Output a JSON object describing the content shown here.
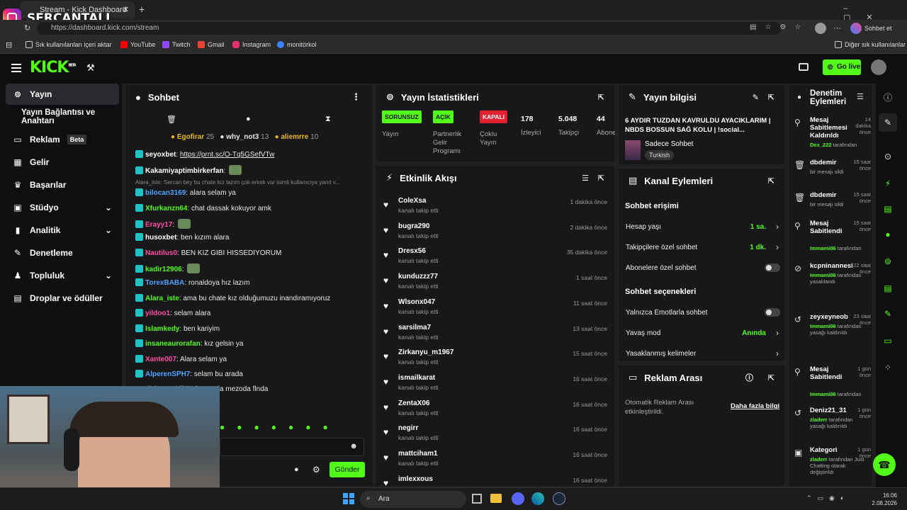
{
  "browser": {
    "tab_title": "Stream - Kick Dashboard",
    "url": "https://dashboard.kick.com/stream",
    "bookmarks": [
      "Sık kullanılanları içeri aktar",
      "YouTube",
      "Twitch",
      "Gmail",
      "Instagram",
      "monitörkol"
    ],
    "other_bookmarks": "Diğer sık kullanılanlar",
    "chat_button": "Sohbet et"
  },
  "overlay": {
    "streamer": "SERCANTALL"
  },
  "header": {
    "logo": "KICK",
    "logo_sup": "BETA",
    "go_live": "Go live"
  },
  "sidebar": {
    "items": [
      {
        "label": "Yayın",
        "icon": "broadcast-icon"
      },
      {
        "label": "Yayın Bağlantısı ve Anahtarı"
      },
      {
        "label": "Reklam",
        "badge": "Beta"
      },
      {
        "label": "Gelir"
      },
      {
        "label": "Başarılar"
      },
      {
        "label": "Stüdyo"
      },
      {
        "label": "Analitik"
      },
      {
        "label": "Denetleme"
      },
      {
        "label": "Topluluk"
      },
      {
        "label": "Droplar ve ödüller"
      }
    ]
  },
  "chat": {
    "title": "Sohbet",
    "top": [
      {
        "name": "Egofirar",
        "n": "25",
        "color": "#e8b923"
      },
      {
        "name": "why_not3",
        "n": "13",
        "color": "#ffffff"
      },
      {
        "name": "aliemrre",
        "n": "10",
        "color": "#e8b923"
      }
    ],
    "messages": [
      {
        "user": "seyoxbet",
        "color": "#ffffff",
        "text": "https://prnt.sc/O-Tq5GSefVTw"
      },
      {
        "user": "Kakamiyaptimbirkerfan",
        "color": "#ffffff",
        "text": ""
      },
      {
        "user": "",
        "color": "#888888",
        "text": "Alara_iste: Sercan bey bu chate kız lazım çok erkek var isimli kullanıcıya yanıt v..."
      },
      {
        "user": "bilocan3169",
        "color": "#4fa3ff",
        "text": "alara selam ya"
      },
      {
        "user": "Xfurkanzn64",
        "color": "#53fc18",
        "text": "chat dassak kokuyor amk"
      },
      {
        "user": "Erayy17",
        "color": "#ff4fa3",
        "text": ""
      },
      {
        "user": "husoxbet",
        "color": "#ffffff",
        "text": "ben kızım alara"
      },
      {
        "user": "Nautilus0",
        "color": "#ff4fa3",
        "text": "BEN KIZ GIBI HISSEDIYORUM"
      },
      {
        "user": "kadir12906",
        "color": "#53fc18",
        "text": ""
      },
      {
        "user": "TorexBABA",
        "color": "#4fa3ff",
        "text": "ronaldoya hız lazım"
      },
      {
        "user": "Alara_iste",
        "color": "#53fc18",
        "text": "ama bu chate kız olduğumuzu inandıramıyoruz"
      },
      {
        "user": "yildoo1",
        "color": "#ff4fa3",
        "text": "selam alara"
      },
      {
        "user": "Islamkedy",
        "color": "#53fc18",
        "text": "ben kariyim"
      },
      {
        "user": "insaneaurorafan",
        "color": "#53fc18",
        "text": "kız gelsin ya"
      },
      {
        "user": "Xante007",
        "color": "#ff4fa3",
        "text": "Alara selam ya"
      },
      {
        "user": "AlperenSPH7",
        "color": "#4fa3ff",
        "text": "selam bu arada"
      },
      {
        "user": "",
        "color": "#ffffff",
        "text": "modluk yapabilitim bu arada mezoda flnda"
      }
    ],
    "send": "Gönder"
  },
  "stats": {
    "title": "Yayın İstatistikleri",
    "items": [
      {
        "tag": "SORUNSUZ",
        "tag_color": "#53fc18",
        "label": "Yayın"
      },
      {
        "tag": "AÇIK",
        "tag_color": "#53fc18",
        "label": "Partnerlik Gelir Programı"
      },
      {
        "tag": "KAPALI",
        "tag_color": "#e5202e",
        "label": "Çoklu Yayın"
      },
      {
        "num": "178",
        "label": "İzleyici"
      },
      {
        "num": "5.048",
        "label": "Takipçi"
      },
      {
        "num": "44",
        "label": "Abone Sayısı"
      }
    ]
  },
  "events": {
    "title": "Etkinlik Akışı",
    "items": [
      {
        "name": "ColeXsa",
        "sub": "kanalı takip etti",
        "time": "1 dakika önce"
      },
      {
        "name": "bugra290",
        "sub": "kanalı takip etti",
        "time": "2 dakika önce"
      },
      {
        "name": "Dresx56",
        "sub": "kanalı takip etti",
        "time": "35 dakika önce"
      },
      {
        "name": "kunduzzz77",
        "sub": "kanalı takip etti",
        "time": "1 saat önce"
      },
      {
        "name": "Wlsonx047",
        "sub": "kanalı takip etti",
        "time": "11 saat önce"
      },
      {
        "name": "sarsilma7",
        "sub": "kanalı takip etti",
        "time": "13 saat önce"
      },
      {
        "name": "Zirkanyu_m1967",
        "sub": "kanalı takip etti",
        "time": "15 saat önce"
      },
      {
        "name": "ismailkarat",
        "sub": "kanalı takip etti",
        "time": "16 saat önce"
      },
      {
        "name": "ZentaX06",
        "sub": "kanalı takip etti",
        "time": "16 saat önce"
      },
      {
        "name": "negirr",
        "sub": "kanalı takip etti",
        "time": "16 saat önce"
      },
      {
        "name": "mattciham1",
        "sub": "kanalı takip etti",
        "time": "16 saat önce"
      },
      {
        "name": "imlexxous",
        "sub": "",
        "time": "16 saat önce"
      }
    ]
  },
  "info": {
    "title": "Yayın bilgisi",
    "stream_title": "6 AYDIR TUZDAN KAVRULDU AYACIKLARIM | NBDS BOSSUN SAĞ KOLU | !social...",
    "category": "Sadece Sohbet",
    "lang": "Turkish"
  },
  "actions": {
    "title": "Kanal Eylemleri",
    "access_title": "Sohbet erişimi",
    "rows": [
      {
        "label": "Hesap yaşı",
        "value": "1 sa."
      },
      {
        "label": "Takipçilere özel sohbet",
        "value": "1 dk."
      },
      {
        "label": "Abonelere özel sohbet",
        "toggle": true
      }
    ],
    "options_title": "Sohbet seçenekleri",
    "rows2": [
      {
        "label": "Yalnızca Emotlarla sohbet",
        "toggle": true
      },
      {
        "label": "Yavaş mod",
        "value": "Anında"
      },
      {
        "label": "Yasaklanmış kelimeler"
      }
    ]
  },
  "ads": {
    "title": "Reklam Arası",
    "text": "Otomatik Reklam Arası etkinleştirildi.",
    "link": "Daha fazla bilgi"
  },
  "mod": {
    "title": "Denetim Eylemleri",
    "items": [
      {
        "icon": "pin-icon",
        "title": "Mesaj Sabitlemesi Kaldırıldı",
        "when": "14 dakika önce",
        "by": "Dex_222",
        "sub": "tarafından"
      },
      {
        "icon": "trash-icon",
        "title": "dbdemir",
        "when": "15 saat önce",
        "by": "",
        "sub": "bir mesajı sildi"
      },
      {
        "icon": "trash-icon",
        "title": "dbdemir",
        "when": "15 saat önce",
        "by": "",
        "sub": "bir mesajı sildi"
      },
      {
        "icon": "pin-icon",
        "title": "Mesaj Sabitlendi",
        "when": "15 saat önce",
        "by": "Immami06",
        "sub": "tarafından"
      },
      {
        "icon": "ban-icon",
        "title": "kcpninannesi",
        "when": "22 saat önce",
        "by": "Immami06",
        "sub": "tarafından yasaklandı"
      },
      {
        "icon": "undo-icon",
        "title": "zeyxeyneob",
        "when": "23 saat önce",
        "by": "Immami06",
        "sub": "tarafından yasağı kaldırıldı"
      },
      {
        "icon": "pin-icon",
        "title": "Mesaj Sabitlendi",
        "when": "1 gün önce",
        "by": "Immami06",
        "sub": "tarafından"
      },
      {
        "icon": "undo-icon",
        "title": "Deniz21_31",
        "when": "1 gün önce",
        "by": "zladerr",
        "sub": "tarafından yasağı kaldırıldı"
      },
      {
        "icon": "category-icon",
        "title": "Kategori",
        "when": "1 gün önce",
        "by": "zladerr",
        "sub": "tarafından Just Chatting olarak değiştirildi"
      }
    ]
  },
  "taskbar": {
    "search": "Ara",
    "time": "16:06",
    "date": "2.08.2026"
  }
}
